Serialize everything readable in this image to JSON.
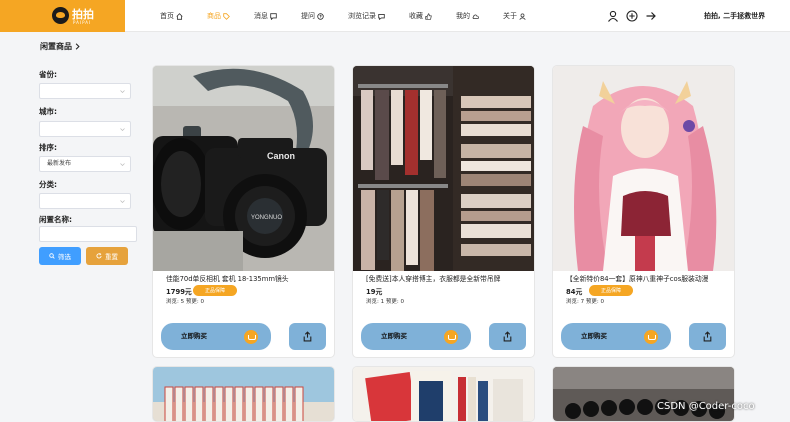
{
  "header": {
    "logo_text": "拍拍",
    "logo_sub": "PAIPAI",
    "nav": [
      {
        "label": "首页",
        "icon": "home-icon"
      },
      {
        "label": "商品",
        "icon": "tag-icon"
      },
      {
        "label": "消息",
        "icon": "chat-icon"
      },
      {
        "label": "提问",
        "icon": "question-icon"
      },
      {
        "label": "浏览记录",
        "icon": "history-icon"
      },
      {
        "label": "收藏",
        "icon": "like-icon"
      },
      {
        "label": "我的",
        "icon": "cloud-icon"
      },
      {
        "label": "关于",
        "icon": "user-icon"
      }
    ],
    "active_nav": "商品",
    "right_icons": [
      "user-icon",
      "plus-circle-icon",
      "arrow-right-icon"
    ],
    "slogan": "拍拍, 二手拯救世界",
    "accent_color": "#f5a623"
  },
  "breadcrumb": "闲置商品",
  "filters": {
    "province_label": "省份:",
    "province_value": "",
    "city_label": "城市:",
    "city_value": "",
    "sort_label": "排序:",
    "sort_value": "最新发布",
    "category_label": "分类:",
    "category_value": "",
    "name_label": "闲置名称:",
    "name_value": "",
    "filter_button": "筛选",
    "reset_button": "重置",
    "filter_color": "#409eff",
    "reset_color": "#e6a23c"
  },
  "products": [
    {
      "title": "佳能70d单反相机 套机 18-135mm镜头",
      "price": "1799元",
      "badge": "正品保障",
      "stats": "浏览: 5  预更: 0",
      "buy_label": "立即购买"
    },
    {
      "title": "[免费送]本人穿搭博主，衣服都是全新带吊牌",
      "price": "19元",
      "badge": "",
      "stats": "浏览: 1  预更: 0",
      "buy_label": "立即购买"
    },
    {
      "title": "【全新特价84一套】原神八重神子cos服装动漫",
      "price": "84元",
      "badge": "正品保障",
      "stats": "浏览: 7  预更: 0",
      "buy_label": "立即购买"
    }
  ],
  "watermark": "CSDN @Coder-coco"
}
